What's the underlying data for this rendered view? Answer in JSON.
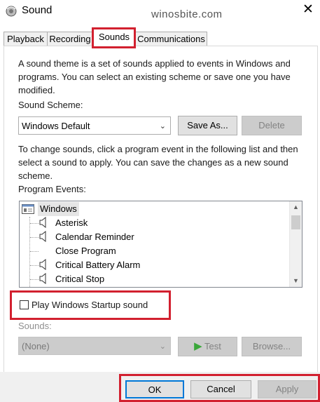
{
  "window": {
    "title": "Sound",
    "watermark": "winosbite.com",
    "close_glyph": "✕"
  },
  "tabs": [
    {
      "label": "Playback"
    },
    {
      "label": "Recording"
    },
    {
      "label": "Sounds",
      "active": true
    },
    {
      "label": "Communications"
    }
  ],
  "sounds": {
    "description": "A sound theme is a set of sounds applied to events in Windows and programs.  You can select an existing scheme or save one you have modified.",
    "scheme_label": "Sound Scheme:",
    "scheme_value": "Windows Default",
    "save_as_label": "Save As...",
    "delete_label": "Delete",
    "instructions": "To change sounds, click a program event in the following list and then select a sound to apply.  You can save the changes as a new sound scheme.",
    "program_events_label": "Program Events:",
    "events": {
      "group": "Windows",
      "items": [
        {
          "label": "Asterisk",
          "icon": "speaker-icon"
        },
        {
          "label": "Calendar Reminder",
          "icon": "speaker-icon"
        },
        {
          "label": "Close Program",
          "icon": ""
        },
        {
          "label": "Critical Battery Alarm",
          "icon": "speaker-icon"
        },
        {
          "label": "Critical Stop",
          "icon": "speaker-icon"
        }
      ]
    },
    "startup_checkbox_label": "Play Windows Startup sound",
    "startup_checked": false,
    "sounds_label": "Sounds:",
    "sounds_value": "(None)",
    "test_label": "Test",
    "browse_label": "Browse..."
  },
  "footer": {
    "ok_label": "OK",
    "cancel_label": "Cancel",
    "apply_label": "Apply"
  },
  "colors": {
    "highlight_red": "#d2202f",
    "ok_border": "#0078d7"
  }
}
